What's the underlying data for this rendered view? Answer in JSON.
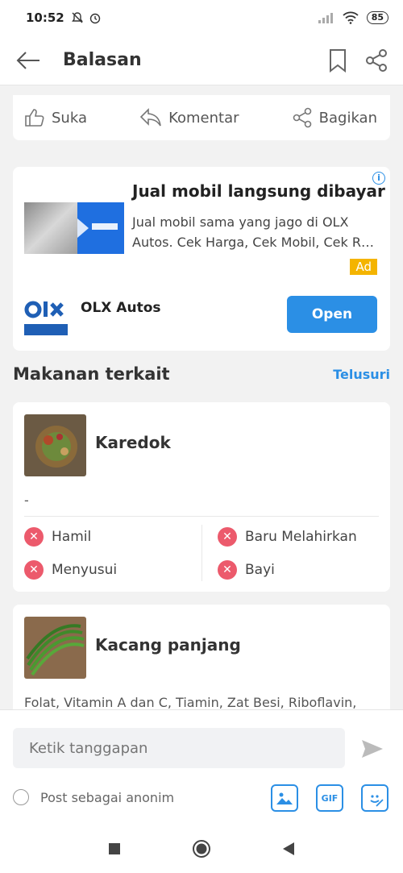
{
  "status": {
    "time": "10:52",
    "battery": "85"
  },
  "appbar": {
    "title": "Balasan"
  },
  "actions": {
    "like": "Suka",
    "comment": "Komentar",
    "share": "Bagikan"
  },
  "ad": {
    "headline": "Jual mobil langsung dibayar",
    "description": "Jual mobil sama yang jago di OLX Autos. Cek Harga, Cek Mobil, Cek R…",
    "badge": "Ad",
    "brand": "OLX Autos",
    "open_label": "Open",
    "info": "i"
  },
  "section": {
    "title": "Makanan terkait",
    "link": "Telusuri"
  },
  "foods": [
    {
      "name": "Karedok",
      "desc": "-",
      "conditions": [
        "Hamil",
        "Baru Melahirkan",
        "Menyusui",
        "Bayi"
      ]
    },
    {
      "name": "Kacang panjang",
      "desc": "Folat, Vitamin A dan C, Tiamin, Zat Besi, Riboflavin,"
    }
  ],
  "composer": {
    "placeholder": "Ketik tanggapan",
    "anon_label": "Post sebagai anonim",
    "gif_label": "GIF"
  },
  "colors": {
    "accent": "#2b8fe5",
    "danger": "#ec5a6c",
    "ad_badge": "#f4b400"
  }
}
